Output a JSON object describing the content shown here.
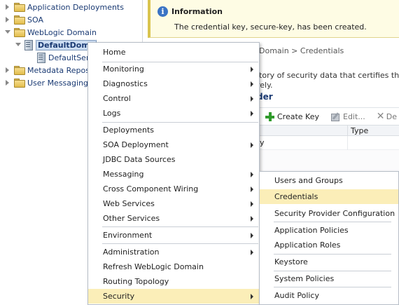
{
  "tree": {
    "items": [
      {
        "label": "Application Deployments",
        "twisty": "closed",
        "icon": "folder-icon"
      },
      {
        "label": "SOA",
        "twisty": "closed",
        "icon": "folder-icon"
      },
      {
        "label": "WebLogic Domain",
        "twisty": "open",
        "icon": "folder-icon"
      },
      {
        "label": "DefaultDoma",
        "twisty": "open",
        "icon": "server-icon",
        "selected": true
      },
      {
        "label": "DefaultSer",
        "twisty": "none",
        "icon": "server-icon"
      },
      {
        "label": "Metadata Reposit",
        "twisty": "closed",
        "icon": "folder-icon"
      },
      {
        "label": "User Messaging S",
        "twisty": "closed",
        "icon": "folder-icon"
      }
    ]
  },
  "info": {
    "icon": "i",
    "title": "Information",
    "message": "The credential key, secure-key, has been created."
  },
  "breadcrumb": "Domain > Credentials",
  "description": {
    "line1": "itory of security data that certifies the au",
    "line2": "rely."
  },
  "section_title": "der",
  "toolbar": {
    "create_key": "Create Key",
    "edit": "Edit...",
    "delete": "De"
  },
  "table": {
    "column_type": "Type",
    "row_cell": "y"
  },
  "menu": {
    "items": [
      {
        "label": "Home",
        "submenu": false
      },
      {
        "label": "Monitoring",
        "submenu": true
      },
      {
        "label": "Diagnostics",
        "submenu": true
      },
      {
        "label": "Control",
        "submenu": true
      },
      {
        "label": "Logs",
        "submenu": true
      },
      {
        "label": "Deployments",
        "submenu": false
      },
      {
        "label": "SOA Deployment",
        "submenu": true
      },
      {
        "label": "JDBC Data Sources",
        "submenu": false
      },
      {
        "label": "Messaging",
        "submenu": true
      },
      {
        "label": "Cross Component Wiring",
        "submenu": true
      },
      {
        "label": "Web Services",
        "submenu": true
      },
      {
        "label": "Other Services",
        "submenu": true
      },
      {
        "label": "Environment",
        "submenu": true
      },
      {
        "label": "Administration",
        "submenu": true
      },
      {
        "label": "Refresh WebLogic Domain",
        "submenu": false
      },
      {
        "label": "Routing Topology",
        "submenu": false
      },
      {
        "label": "Security",
        "submenu": true,
        "highlighted": true
      }
    ]
  },
  "security_menu": {
    "items": [
      {
        "label": "Users and Groups"
      },
      {
        "label": "Credentials",
        "highlighted": true
      },
      {
        "label": "Security Provider Configuration"
      },
      {
        "label": "Application Policies"
      },
      {
        "label": "Application Roles"
      },
      {
        "label": "Keystore"
      },
      {
        "label": "System Policies"
      },
      {
        "label": "Audit Policy"
      }
    ]
  },
  "colors": {
    "menu_highlight": "#fbeeb8",
    "info_background": "#fefce4",
    "tree_link": "#1a3a73",
    "add_icon": "#2f9a2b"
  }
}
